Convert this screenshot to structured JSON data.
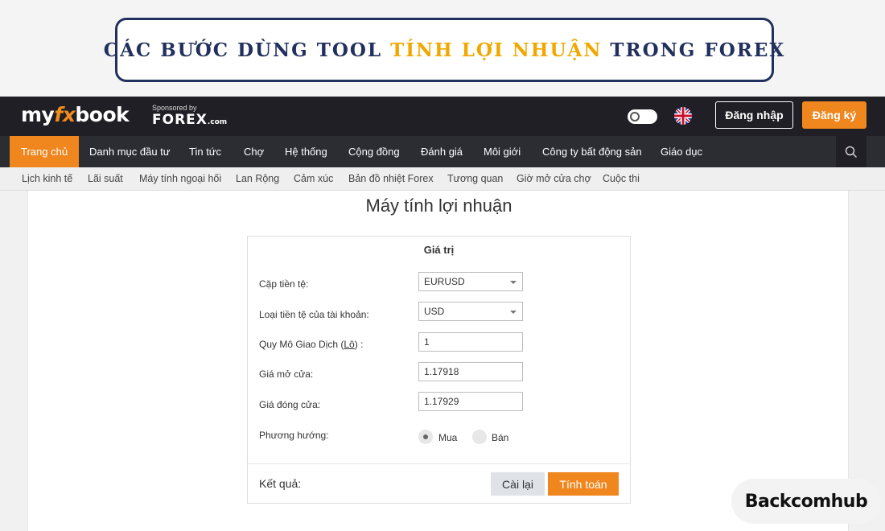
{
  "banner": {
    "title_prefix": "CÁC BƯỚC DÙNG TOOL ",
    "title_highlight": "TÍNH LỢI NHUẬN",
    "title_suffix": " TRONG FOREX",
    "border_color": "#22305e",
    "highlight_color": "#f0a800"
  },
  "header": {
    "logo_part1": "my",
    "logo_part2": "fx",
    "logo_part3": "book",
    "sponsor_small": "Sponsored by",
    "sponsor_brand": "FOREX",
    "sponsor_suffix": ".com",
    "login_label": "Đăng nhập",
    "register_label": "Đăng ký",
    "accent_color": "#f0861e"
  },
  "main_nav": {
    "items": [
      {
        "label": "Trang chủ",
        "active": true
      },
      {
        "label": "Danh mục đầu tư"
      },
      {
        "label": "Tin tức"
      },
      {
        "label": "Chợ"
      },
      {
        "label": "Hệ thống"
      },
      {
        "label": "Cộng đồng"
      },
      {
        "label": "Đánh giá"
      },
      {
        "label": "Môi giới"
      },
      {
        "label": "Công ty bất động sản"
      },
      {
        "label": "Giáo dục"
      }
    ]
  },
  "sub_nav": {
    "items": [
      {
        "label": "Lịch kinh tế"
      },
      {
        "label": "Lãi suất"
      },
      {
        "label": "Máy tính ngoại hối"
      },
      {
        "label": "Lan Rộng"
      },
      {
        "label": "Cảm xúc"
      },
      {
        "label": "Bản đồ nhiệt Forex"
      },
      {
        "label": "Tương quan"
      },
      {
        "label": "Giờ mở cửa chợ"
      },
      {
        "label": "Cuộc thi"
      }
    ]
  },
  "calculator": {
    "page_title": "Máy tính lợi nhuận",
    "panel_header": "Giá trị",
    "fields": [
      {
        "label": "Cặp tiền tệ:",
        "value": "EURUSD"
      },
      {
        "label": "Loại tiền tệ của tài khoản:",
        "value": "USD"
      },
      {
        "label_prefix": "Quy Mô Giao Dịch (",
        "label_link": "Lô",
        "label_suffix": ") :",
        "value": "1"
      },
      {
        "label": "Giá mở cửa:",
        "value": "1.17918"
      },
      {
        "label": "Giá đóng cửa:",
        "value": "1.17929"
      }
    ],
    "direction_label": "Phương hướng:",
    "direction_options": [
      {
        "label": "Mua",
        "selected": true
      },
      {
        "label": "Bán",
        "selected": false
      }
    ],
    "result_label": "Kết quả:",
    "reset_label": "Cài lại",
    "calculate_label": "Tính toán"
  },
  "watermark": {
    "text": "Backcomhub"
  }
}
